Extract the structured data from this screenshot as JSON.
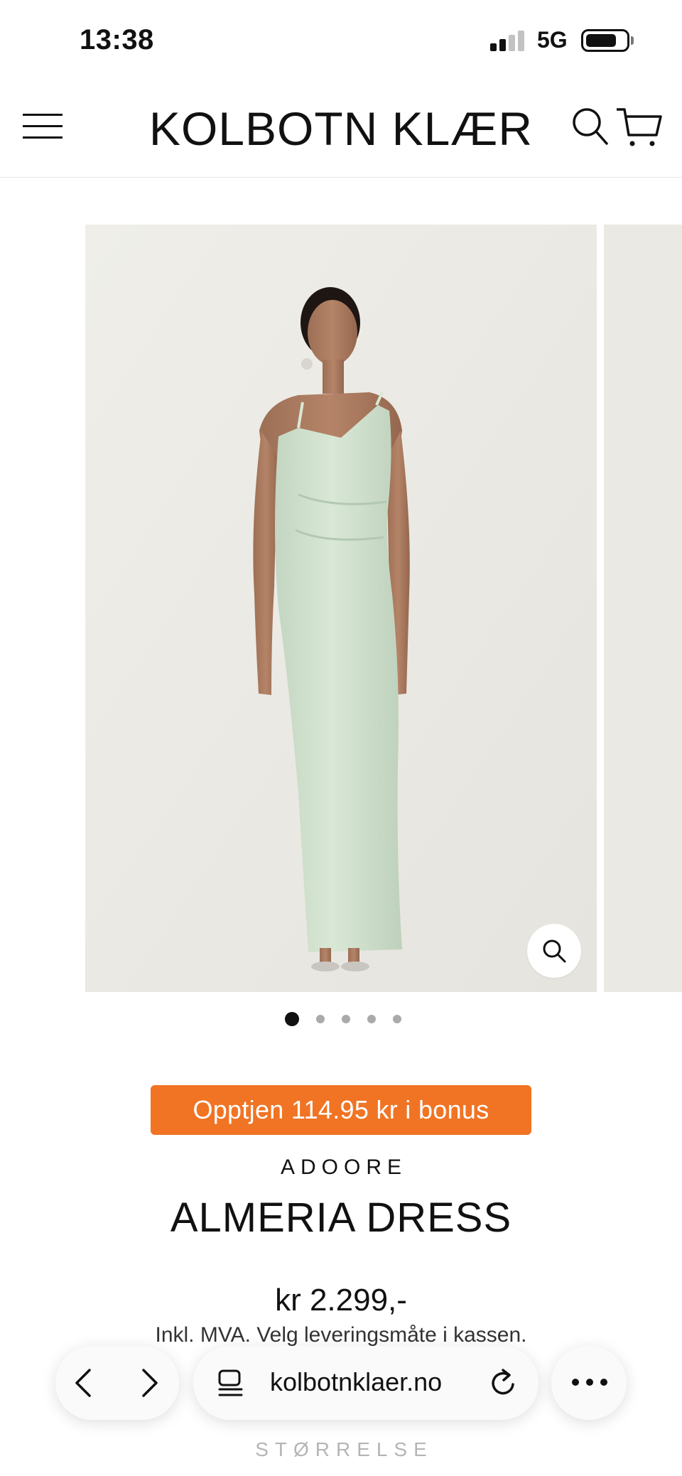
{
  "status_bar": {
    "time": "13:38",
    "network": "5G",
    "battery_level": 0.75
  },
  "header": {
    "brand": "KOLBOTN KLÆR"
  },
  "gallery": {
    "image_count": 5,
    "active_index": 0
  },
  "product": {
    "bonus_label": "Opptjen 114.95 kr i bonus",
    "vendor": "ADOORE",
    "title": "ALMERIA DRESS",
    "price": "kr 2.299,-",
    "vat_note": "Inkl. MVA. Velg leveringsmåte i kassen.",
    "size_label": "STØRRELSE"
  },
  "browser": {
    "url": "kolbotnklaer.no"
  },
  "colors": {
    "accent": "#f07424",
    "text": "#111111",
    "dress": "#cfe0cc",
    "photo_bg": "#ecebe6"
  }
}
